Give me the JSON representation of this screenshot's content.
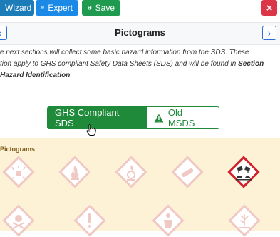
{
  "toolbar": {
    "wizard_label": "Wizard",
    "expert_label": "Expert",
    "save_label": "Save",
    "close_label": "×"
  },
  "header": {
    "title": "Pictograms"
  },
  "intro": {
    "line1": "e next sections will collect some basic hazard information from the SDS. These",
    "line2_prefix": "tion apply to GHS compliant Safety Data Sheets (SDS) and will be found in ",
    "line2_bold": "Section",
    "line3": "Hazard Identification"
  },
  "toggle": {
    "ghs_label": "GHS Compliant SDS",
    "msds_label": "Old MSDS",
    "selected": "GHS Compliant SDS"
  },
  "panel": {
    "title": "Pictograms",
    "pictograms": [
      {
        "name": "exploding-bomb",
        "selected": false
      },
      {
        "name": "flame",
        "selected": false
      },
      {
        "name": "flame-over-circle",
        "selected": false
      },
      {
        "name": "gas-cylinder",
        "selected": false
      },
      {
        "name": "corrosion",
        "selected": true
      },
      {
        "name": "skull-and-crossbones",
        "selected": false
      },
      {
        "name": "exclamation-mark",
        "selected": false
      },
      {
        "name": "health-hazard",
        "selected": false
      },
      {
        "name": "environment",
        "selected": false
      }
    ]
  },
  "colors": {
    "wizard": "#1c7cb7",
    "expert": "#1a8ae6",
    "save": "#1f9b4f",
    "close": "#dc3545",
    "toggle_active": "#1e8a3a",
    "panel_bg": "#fdf1d6",
    "picto_border_inactive": "#f0c9c4",
    "picto_border_active": "#d0222b"
  }
}
